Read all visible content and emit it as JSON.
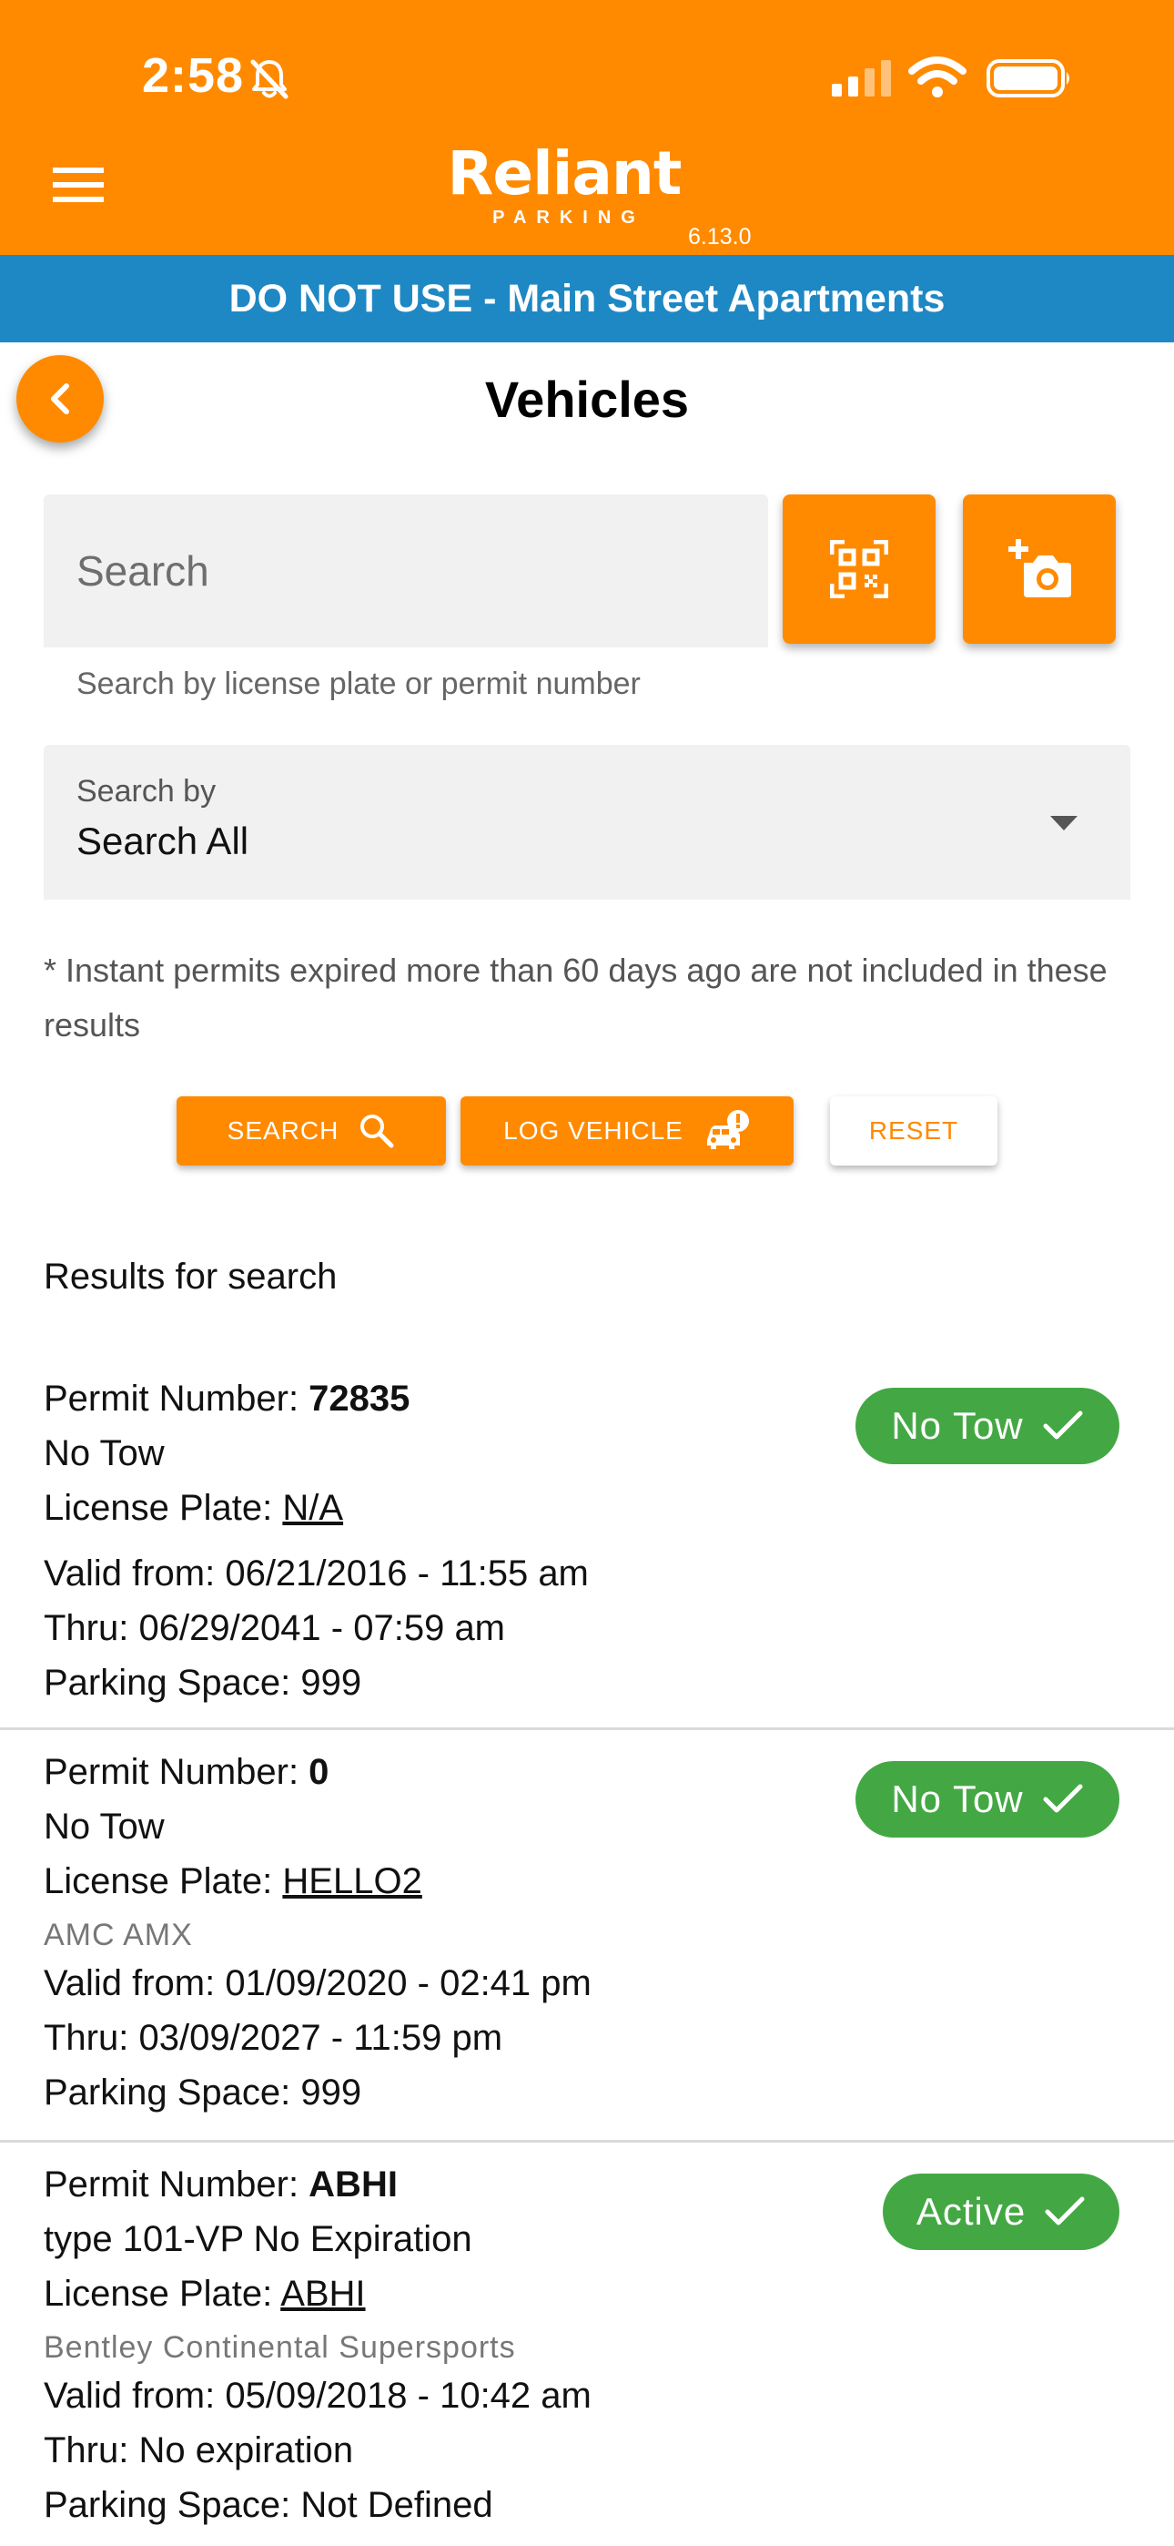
{
  "status_bar": {
    "time": "2:58"
  },
  "header": {
    "logo_main": "Reliant",
    "logo_sub": "PARKING",
    "version": "6.13.0",
    "accent_color": "#ff8a00"
  },
  "banner": {
    "text": "DO NOT USE - Main Street Apartments",
    "color": "#1e88c4"
  },
  "page": {
    "title": "Vehicles"
  },
  "search": {
    "placeholder": "Search",
    "value": "",
    "helper": "Search by license plate or permit number"
  },
  "search_by": {
    "label": "Search by",
    "value": "Search All"
  },
  "note": "* Instant permits expired more than 60 days ago are not included in these results",
  "buttons": {
    "search": "SEARCH",
    "log_vehicle": "LOG VEHICLE",
    "reset": "RESET"
  },
  "results": {
    "title": "Results for search",
    "permit_label": "Permit Number: ",
    "plate_label": "License Plate: ",
    "valid_label": "Valid from: ",
    "thru_label": "Thru: ",
    "space_label": "Parking Space: ",
    "badge_color": "#43a843",
    "items": [
      {
        "permit_number": "72835",
        "type": "No Tow",
        "license_plate": "N/A",
        "vehicle": "",
        "valid_from": "06/21/2016 - 11:55 am",
        "thru": "06/29/2041 - 07:59 am",
        "parking_space": "999",
        "status": "No Tow"
      },
      {
        "permit_number": "0",
        "type": "No Tow",
        "license_plate": "HELLO2",
        "vehicle": "AMC AMX",
        "valid_from": "01/09/2020 - 02:41 pm",
        "thru": "03/09/2027 - 11:59 pm",
        "parking_space": "999",
        "status": "No Tow"
      },
      {
        "permit_number": "ABHI",
        "type": "type 101-VP No Expiration",
        "license_plate": "ABHI",
        "vehicle": "Bentley Continental Supersports",
        "valid_from": "05/09/2018 - 10:42 am",
        "thru": "No expiration",
        "parking_space": "Not Defined",
        "status": "Active"
      }
    ]
  }
}
